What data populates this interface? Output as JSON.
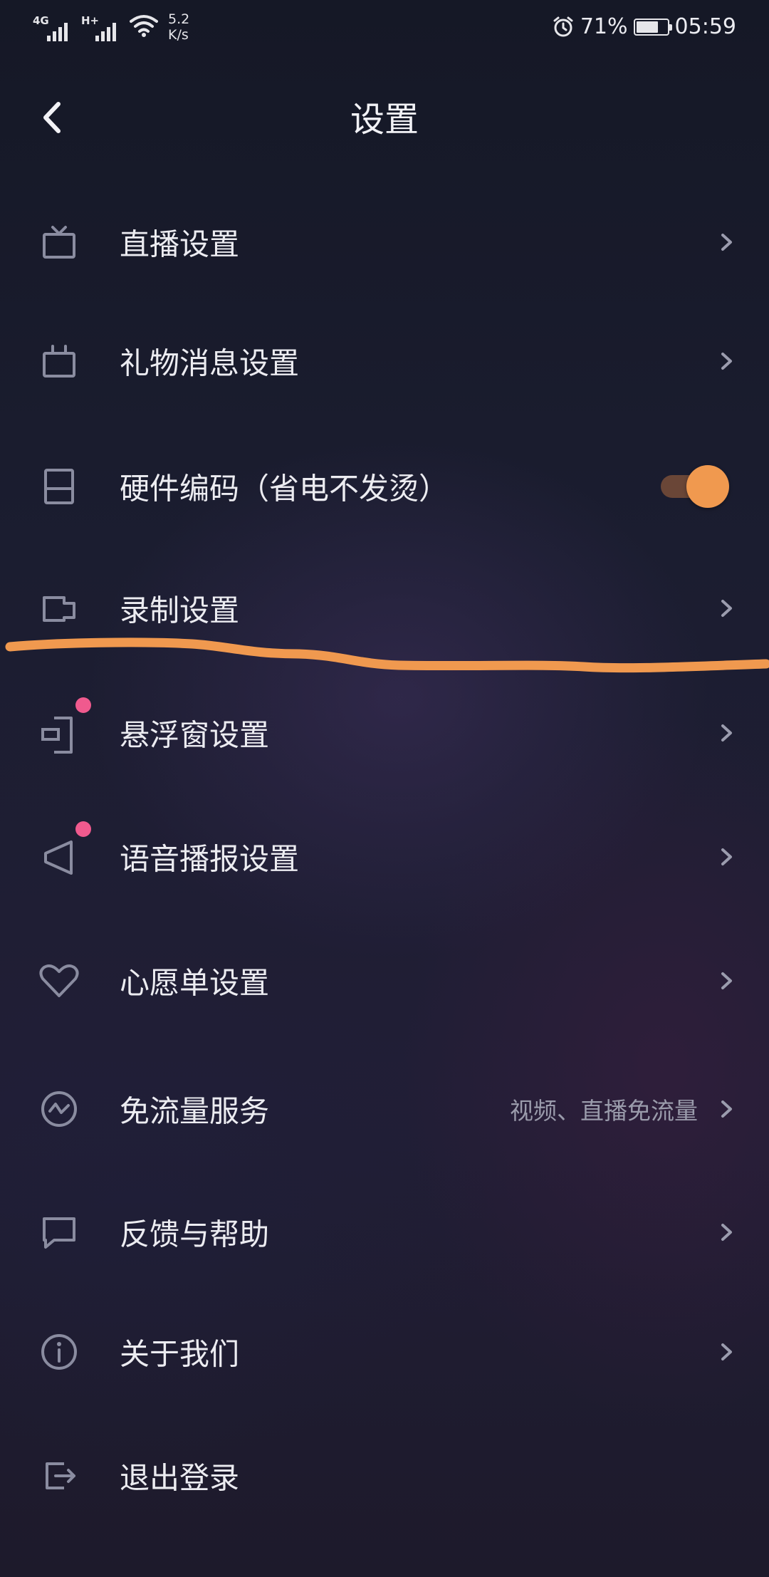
{
  "status_bar": {
    "signal1_tag": "4G",
    "signal2_tag": "H+",
    "net_speed_value": "5.2",
    "net_speed_unit": "K/s",
    "battery_percent": "71%",
    "battery_level": 0.71,
    "time": "05:59"
  },
  "header": {
    "title": "设置",
    "back_icon": "chevron-left-icon"
  },
  "menu": [
    {
      "label": "直播设置",
      "icon": "tv-icon"
    },
    {
      "label": "礼物消息设置",
      "icon": "gift-box-icon"
    },
    {
      "label": "硬件编码（省电不发烫）",
      "icon": "hardware-icon",
      "toggle_on": true
    },
    {
      "label": "录制设置",
      "icon": "record-icon"
    },
    {
      "label": "悬浮窗设置",
      "icon": "floating-window-icon",
      "badge": true
    },
    {
      "label": "语音播报设置",
      "icon": "speaker-icon",
      "badge": true
    },
    {
      "label": "心愿单设置",
      "icon": "heart-icon"
    },
    {
      "label": "免流量服务",
      "icon": "data-free-icon",
      "sub": "视频、直播免流量"
    },
    {
      "label": "反馈与帮助",
      "icon": "chat-bubble-icon"
    },
    {
      "label": "关于我们",
      "icon": "info-icon"
    },
    {
      "label": "退出登录",
      "icon": "logout-icon"
    }
  ],
  "colors": {
    "accent": "#f0994f",
    "badge": "#f05a8e",
    "icon": "#8a8ca0",
    "chevron": "#9b9cae"
  }
}
